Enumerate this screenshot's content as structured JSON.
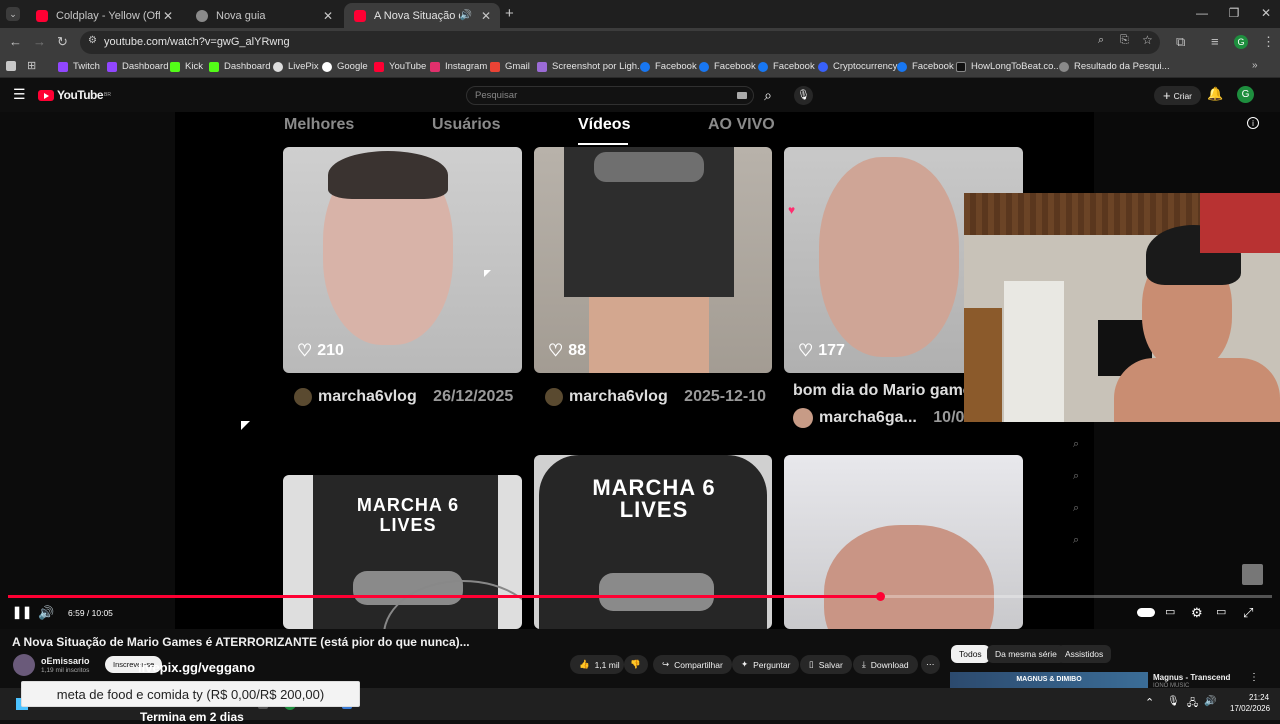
{
  "tabs": [
    {
      "title": "Coldplay - Yellow (Official Vide",
      "favicon_color": "#ff0033"
    },
    {
      "title": "Nova guia",
      "favicon_color": "#8a8a8a"
    },
    {
      "title": "A Nova Situação de Mario",
      "favicon_color": "#ff0033"
    }
  ],
  "new_tab": "+",
  "url": "youtube.com/watch?v=gwG_alYRwng",
  "bookmarks": [
    "Twitch",
    "Dashboard",
    "Kick",
    "Dashboard",
    "LivePix",
    "Google",
    "YouTube",
    "Instagram",
    "Gmail",
    "Screenshot por Ligh...",
    "Facebook",
    "Facebook",
    "Facebook",
    "Cryptocurrency",
    "Facebook",
    "HowLongToBeat.co...",
    "Resultado da Pesqui..."
  ],
  "youtube": {
    "logo": "YouTube",
    "region": "BR",
    "search_placeholder": "Pesquisar",
    "create_label": "Criar",
    "avatar_letter": "G"
  },
  "video_content": {
    "tabs": [
      "Melhores",
      "Usuários",
      "Vídeos",
      "AO VIVO"
    ],
    "active_tab": "Vídeos",
    "row1": [
      {
        "likes": "210",
        "user": "marcha6vlog",
        "date": "26/12/2025"
      },
      {
        "likes": "88",
        "user": "marcha6vlog",
        "date": "2025-12-10"
      },
      {
        "likes": "177",
        "caption": "bom dia do Mario game",
        "user": "marcha6ga...",
        "date": "10/0"
      }
    ],
    "shirt_text": "MARCHA 6 LIVES"
  },
  "player": {
    "time": "6:59 / 10:05",
    "progress": 0.69
  },
  "video": {
    "title": "A Nova Situação de Mario Games é ATERRORIZANTE (está pior do que nunca)...",
    "channel": "oEmissario",
    "subscribers": "1,19 mil inscritos",
    "subscribe_label": "Inscrever-se",
    "overlay_link": "livepix.gg/veggano",
    "likes": "1,1 mil",
    "share": "Compartilhar",
    "ask": "Perguntar",
    "save": "Salvar",
    "download": "Download",
    "goal_text": "meta de food e comida ty (R$ 0,00/R$ 200,00)",
    "goal_footer": "Termina em 2 dias"
  },
  "chips": [
    "Todos",
    "Da mesma série",
    "Assistidos"
  ],
  "upnext": {
    "title": "Magnus - Transcend",
    "thumb_text": "MAGNUS & DIMIBO",
    "channel": "IONO MUSIC"
  },
  "taskbar": {
    "time": "21:24",
    "date": "17/02/2026"
  }
}
